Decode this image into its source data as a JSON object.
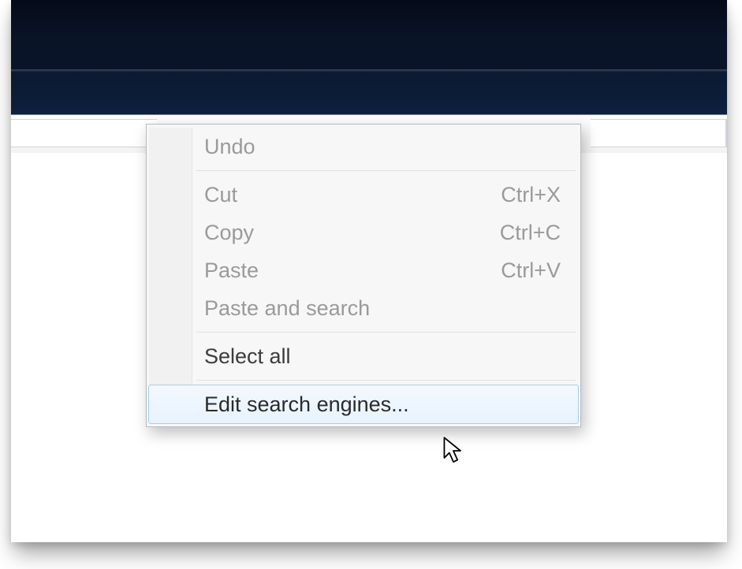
{
  "contextMenu": {
    "items": [
      {
        "label": "Undo",
        "shortcut": "",
        "enabled": false
      },
      {
        "sep": true
      },
      {
        "label": "Cut",
        "shortcut": "Ctrl+X",
        "enabled": false
      },
      {
        "label": "Copy",
        "shortcut": "Ctrl+C",
        "enabled": false
      },
      {
        "label": "Paste",
        "shortcut": "Ctrl+V",
        "enabled": false
      },
      {
        "label": "Paste and search",
        "shortcut": "",
        "enabled": false
      },
      {
        "sep": true
      },
      {
        "label": "Select all",
        "shortcut": "",
        "enabled": true
      },
      {
        "sep": true
      },
      {
        "label": "Edit search engines...",
        "shortcut": "",
        "enabled": true,
        "hover": true
      }
    ]
  }
}
